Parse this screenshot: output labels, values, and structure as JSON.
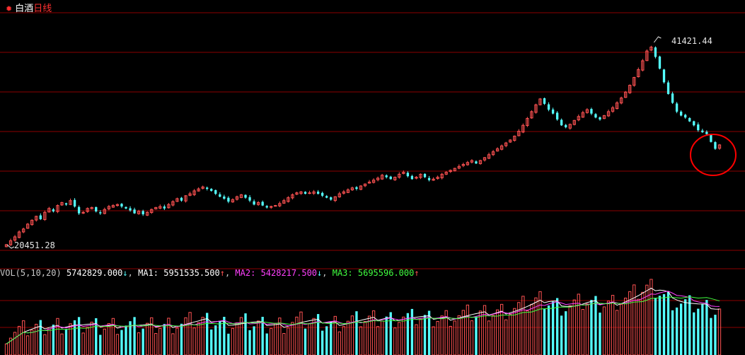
{
  "header": {
    "name": "白酒",
    "period": "日线"
  },
  "annotations": {
    "high": "41421.44",
    "low": "20451.28"
  },
  "volume_panel": {
    "label": "VOL(5,10,20)",
    "value": "5742829.000",
    "value_arrow": "↓",
    "ma1_label": "MA1:",
    "ma1_value": "5951535.500",
    "ma1_arrow": "↑",
    "ma2_label": "MA2:",
    "ma2_value": "5428217.500",
    "ma2_arrow": "↓",
    "ma3_label": "MA3:",
    "ma3_value": "5695596.000",
    "ma3_arrow": "↑"
  },
  "colors": {
    "background": "#000000",
    "up": "#ff5252",
    "down": "#54ffff",
    "grid": "#8b0000",
    "ma1": "#ffffff",
    "ma2": "#ff40ff",
    "ma3": "#40ff40",
    "highlight_circle": "#ff0000"
  },
  "chart_data": {
    "type": "candlestick",
    "title": "白酒日线",
    "price_range": [
      20451.28,
      41421.44
    ],
    "high_label": 41421.44,
    "low_label": 20451.28,
    "closes": [
      20600,
      21000,
      21400,
      21900,
      22200,
      22700,
      23100,
      23500,
      23200,
      23900,
      24300,
      24000,
      24600,
      24900,
      24700,
      25100,
      24500,
      23800,
      23900,
      24300,
      24400,
      24000,
      23800,
      24200,
      24500,
      24600,
      24700,
      24500,
      24300,
      24100,
      23800,
      24000,
      23700,
      23900,
      24200,
      24400,
      24500,
      24300,
      24700,
      25000,
      25300,
      25100,
      25600,
      25800,
      26100,
      26300,
      26500,
      26300,
      26100,
      25800,
      25500,
      25300,
      25000,
      25200,
      25500,
      25700,
      25400,
      25100,
      24700,
      24900,
      24600,
      24400,
      24500,
      24600,
      24800,
      25100,
      25400,
      25700,
      25900,
      26000,
      25800,
      25900,
      26000,
      25800,
      25600,
      25400,
      25200,
      25500,
      25800,
      26000,
      26200,
      26400,
      26300,
      26600,
      26800,
      27000,
      27200,
      27400,
      27700,
      27500,
      27300,
      27500,
      27800,
      28000,
      27600,
      27300,
      27500,
      27800,
      27500,
      27200,
      27300,
      27500,
      27800,
      28000,
      28200,
      28400,
      28600,
      28800,
      29000,
      29200,
      28900,
      29200,
      29500,
      29800,
      30100,
      30400,
      30700,
      31000,
      31300,
      31700,
      32200,
      32800,
      33500,
      34200,
      34900,
      35500,
      35000,
      34400,
      34000,
      33400,
      32800,
      32600,
      32900,
      33300,
      33700,
      34100,
      34400,
      34000,
      33600,
      33400,
      33800,
      34200,
      34600,
      35100,
      35600,
      36200,
      36900,
      37700,
      38500,
      39400,
      40400,
      40800,
      39800,
      38600,
      37200,
      36000,
      35100,
      34200,
      33800,
      33600,
      33200,
      32800,
      32300,
      32100,
      31900,
      31100,
      30400,
      30800
    ]
  }
}
